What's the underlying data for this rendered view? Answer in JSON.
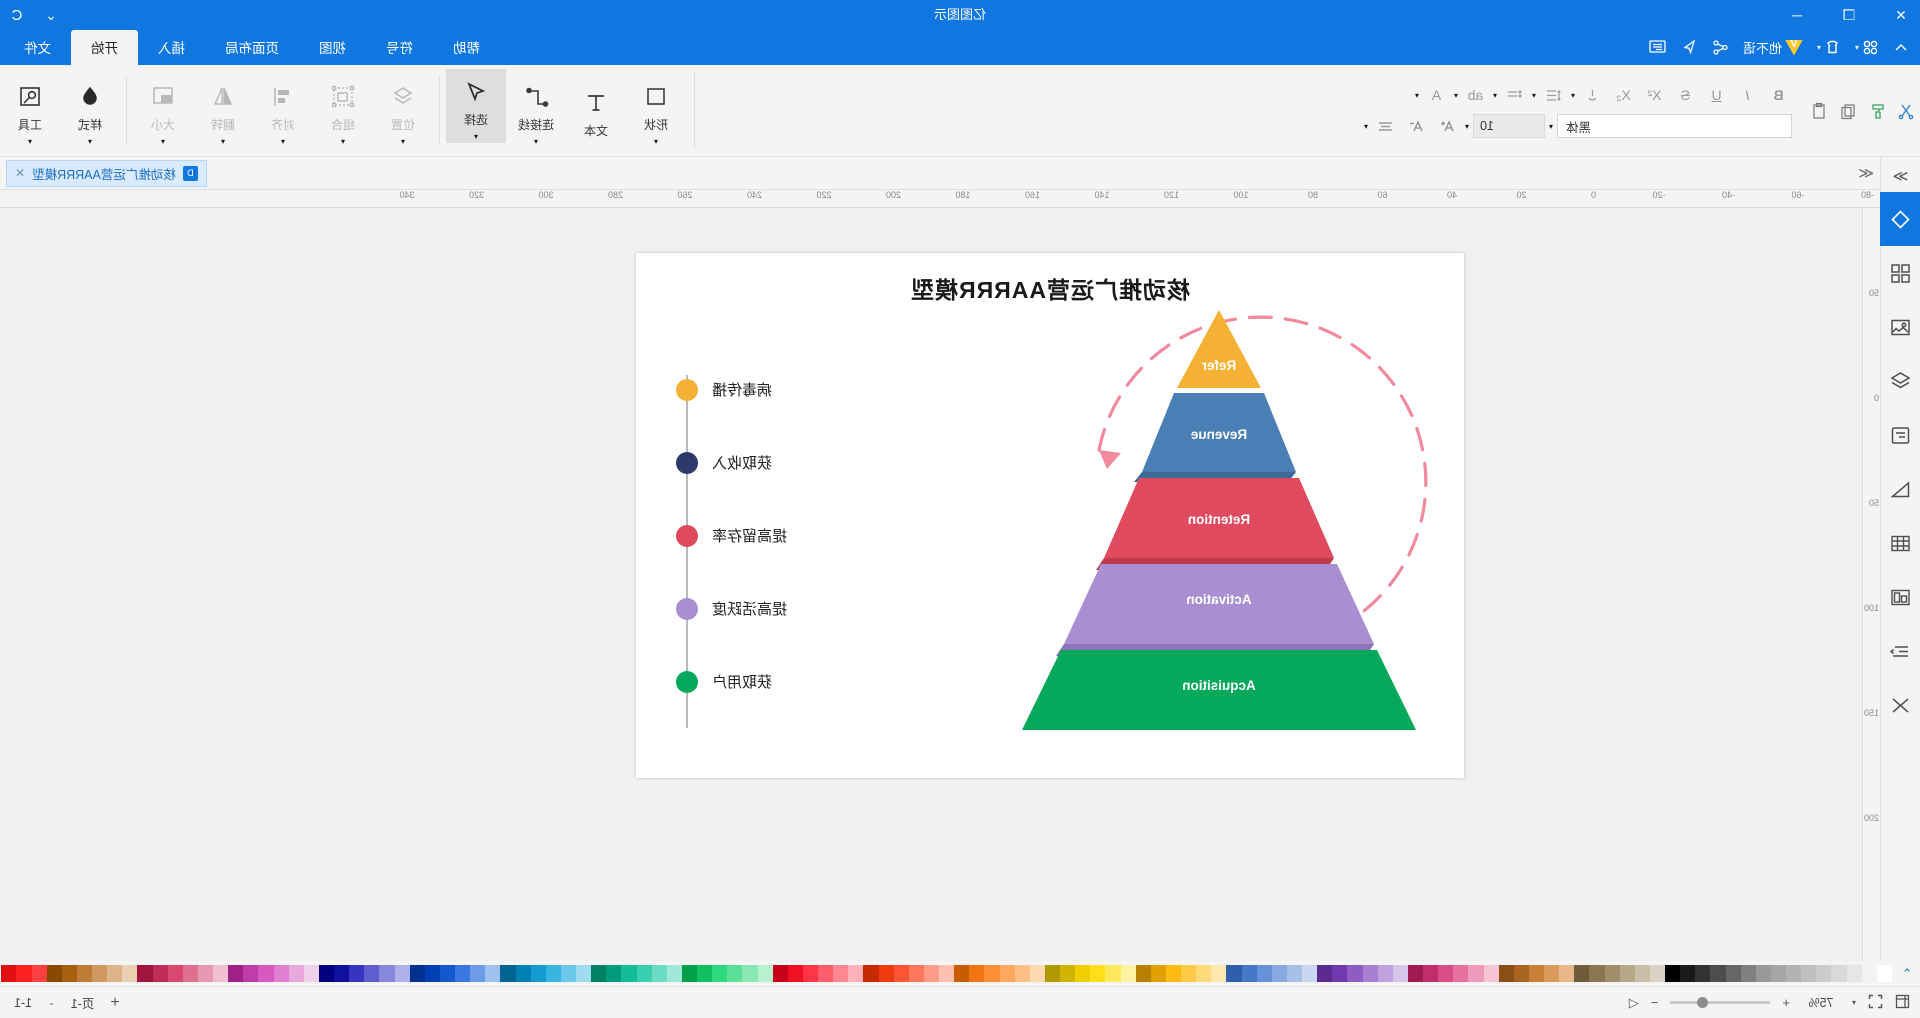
{
  "window": {
    "title": "亿图图示",
    "controls": {
      "close": "✕",
      "restore": "❐",
      "minimize": "─"
    },
    "account_icon": "C",
    "chevron": "⌄"
  },
  "quick_access": {
    "items": [
      {
        "name": "undo",
        "glyph": "↶"
      },
      {
        "name": "redo",
        "glyph": "↷"
      },
      {
        "name": "save",
        "glyph": "💾"
      },
      {
        "name": "print",
        "glyph": "🖨"
      },
      {
        "name": "new",
        "glyph": "🗋"
      },
      {
        "name": "open",
        "glyph": "🗁"
      },
      {
        "name": "add",
        "glyph": "⊞"
      }
    ],
    "left_items": [
      {
        "label": "他不语",
        "type": "vip"
      },
      {
        "label": "",
        "type": "share"
      },
      {
        "label": "",
        "type": "cursor"
      },
      {
        "label": "",
        "type": "comment"
      }
    ]
  },
  "tabs": [
    {
      "label": "文件",
      "active": false
    },
    {
      "label": "开始",
      "active": true
    },
    {
      "label": "插入",
      "active": false
    },
    {
      "label": "页面布局",
      "active": false
    },
    {
      "label": "视图",
      "active": false
    },
    {
      "label": "符号",
      "active": false
    },
    {
      "label": "帮助",
      "active": false
    }
  ],
  "ribbon": {
    "groups": [
      {
        "buttons": [
          {
            "label": "工具",
            "icon": "tools-icon",
            "dim": false,
            "dropdown": true
          },
          {
            "label": "样式",
            "icon": "style-icon",
            "dim": false,
            "dropdown": true
          }
        ]
      },
      {
        "buttons": [
          {
            "label": "大小",
            "icon": "size-icon",
            "dim": true,
            "dropdown": true
          },
          {
            "label": "翻转",
            "icon": "flip-icon",
            "dim": true,
            "dropdown": true
          },
          {
            "label": "对齐",
            "icon": "align-icon",
            "dim": true,
            "dropdown": true
          },
          {
            "label": "组合",
            "icon": "group-icon",
            "dim": true,
            "dropdown": true
          },
          {
            "label": "位置",
            "icon": "position-icon",
            "dim": true,
            "dropdown": true
          }
        ]
      },
      {
        "buttons": [
          {
            "label": "选择",
            "icon": "select-arrow-icon",
            "dim": false,
            "selected": true,
            "dropdown": true
          },
          {
            "label": "连接线",
            "icon": "connector-icon",
            "dim": false,
            "dropdown": true
          },
          {
            "label": "文本",
            "icon": "text-icon",
            "dim": false,
            "dropdown": false
          },
          {
            "label": "形状",
            "icon": "shape-icon",
            "dim": false,
            "dropdown": true
          }
        ]
      }
    ],
    "font": {
      "name": "黑体",
      "size": "10",
      "row1_icons": [
        "align-text-icon",
        "decrease-font-icon",
        "increase-font-icon"
      ],
      "row2_icons": [
        "font-color-icon",
        "highlight-icon",
        "bullets-icon",
        "line-spacing-icon",
        "text-position-icon",
        "subscript-icon",
        "superscript-icon",
        "strikethrough-icon",
        "underline-icon",
        "italic-icon",
        "bold-icon"
      ],
      "right_icons": [
        "copy-icon",
        "paste-icon",
        "format-painter-icon",
        "cut-icon"
      ]
    }
  },
  "document_tab": {
    "label": "核动推广运营AARRR模型",
    "icon": "doc-icon",
    "close": "✕"
  },
  "rail": {
    "items": [
      {
        "name": "diagram-shapes",
        "icon": "diamond-icon",
        "active": true
      },
      {
        "name": "templates",
        "icon": "grid-icon",
        "active": false
      },
      {
        "name": "images",
        "icon": "image-icon",
        "active": false
      },
      {
        "name": "layers",
        "icon": "layers-icon",
        "active": false
      },
      {
        "name": "notes",
        "icon": "note-icon",
        "active": false
      },
      {
        "name": "measure",
        "icon": "measure-icon",
        "active": false
      },
      {
        "name": "table",
        "icon": "table-icon",
        "active": false
      },
      {
        "name": "container",
        "icon": "container-icon",
        "active": false
      },
      {
        "name": "flow",
        "icon": "flow-icon",
        "active": false
      },
      {
        "name": "shuffle",
        "icon": "shuffle-icon",
        "active": false
      }
    ],
    "collapse": "≫"
  },
  "rulers": {
    "horizontal": [
      "-80",
      "-60",
      "-40",
      "-20",
      "0",
      "20",
      "40",
      "60",
      "80",
      "100",
      "120",
      "140",
      "160",
      "180",
      "200",
      "220",
      "240",
      "260",
      "280",
      "300",
      "320",
      "340"
    ],
    "vertical": [
      "50",
      "0",
      "50",
      "100",
      "150",
      "200"
    ]
  },
  "canvas": {
    "diagram_title": "核动推广运营AARRR模型",
    "pyramid_levels": [
      {
        "label": "Refer",
        "color": "#f5b133"
      },
      {
        "label": "Revenue",
        "color": "#4a7fb5"
      },
      {
        "label": "Retention",
        "color": "#e04a5f"
      },
      {
        "label": "Activation",
        "color": "#a98fd1"
      },
      {
        "label": "Acquisition",
        "color": "#06a95b"
      }
    ],
    "legend": [
      {
        "label": "病毒传播",
        "color": "#f5b133"
      },
      {
        "label": "获取收入",
        "color": "#2b3a6b"
      },
      {
        "label": "提高留存率",
        "color": "#e04a5f"
      },
      {
        "label": "提高活跃度",
        "color": "#a98fd1"
      },
      {
        "label": "获取用户",
        "color": "#06a95b"
      }
    ],
    "arrow_color": "#f08a9c"
  },
  "palette": {
    "colors": [
      "#ffffff",
      "#f2f2f2",
      "#e6e6e6",
      "#d9d9d9",
      "#cccccc",
      "#bfbfbf",
      "#b3b3b3",
      "#a6a6a6",
      "#999999",
      "#808080",
      "#666666",
      "#4d4d4d",
      "#333333",
      "#1a1a1a",
      "#000000",
      "#d9d2c5",
      "#c9bfa8",
      "#b8a88a",
      "#a08e6c",
      "#8a7650",
      "#6e5c3c",
      "#e8b88a",
      "#d99a5c",
      "#c97f35",
      "#a86420",
      "#8a4f14",
      "#f7c5d6",
      "#f09bbb",
      "#e8719f",
      "#d94e86",
      "#c22d6b",
      "#a01a52",
      "#d8c6ea",
      "#c0a3de",
      "#a87fd1",
      "#8f5cc4",
      "#7139b0",
      "#5a2a8f",
      "#c9d8f0",
      "#a8c0e8",
      "#87a8e0",
      "#6690d8",
      "#4578c8",
      "#2f5faa",
      "#ffe8b0",
      "#ffd97a",
      "#ffca45",
      "#ffbb10",
      "#e0a000",
      "#b88000",
      "#fff2a0",
      "#ffe85c",
      "#ffdf1a",
      "#f0cf00",
      "#d0b400",
      "#b09800",
      "#ffd9b0",
      "#ffc087",
      "#ffa75e",
      "#ff8e35",
      "#f07510",
      "#c85c00",
      "#ffc0b0",
      "#ff9c87",
      "#ff785e",
      "#ff5435",
      "#f03a10",
      "#c82a00",
      "#ffb0b8",
      "#ff8792",
      "#ff5e6c",
      "#ff3546",
      "#f01024",
      "#c8001a",
      "#b8f0d0",
      "#8ae8b4",
      "#5ce098",
      "#2ed87c",
      "#10c060",
      "#00a04a",
      "#a0e8d8",
      "#6cdcc4",
      "#38d0b0",
      "#14bc98",
      "#009c7c",
      "#008064",
      "#a0dcf0",
      "#6cc8e8",
      "#38b4e0",
      "#149cd0",
      "#0080b4",
      "#006490",
      "#a0c0f0",
      "#6c9ce8",
      "#3878e0",
      "#1458d0",
      "#0040b4",
      "#003090",
      "#b0b0e8",
      "#8787dc",
      "#5e5ed0",
      "#3535c0",
      "#1010a0",
      "#000080",
      "#f0d0e8",
      "#e8a8dc",
      "#e080d0",
      "#d858c0",
      "#c03ca8",
      "#a02088",
      "#f0c0d0",
      "#e898b0",
      "#e07090",
      "#d84870",
      "#c02c58",
      "#a01440",
      "#e8d0b0",
      "#dcb487",
      "#d0985e",
      "#c07c35",
      "#a86010",
      "#8a4800",
      "#ff4040",
      "#ff2020",
      "#e01010"
    ],
    "end_icon": "palette-expand-icon"
  },
  "status": {
    "left_icons": [
      "fit-page-icon",
      "fullscreen-icon"
    ],
    "zoom": "75%",
    "zoom_out": "−",
    "zoom_in": "+",
    "prev_page": "◁",
    "add_page": "+",
    "page_label": "页-1",
    "page_dropdown": "⌄",
    "page_indicator": "1-1"
  }
}
